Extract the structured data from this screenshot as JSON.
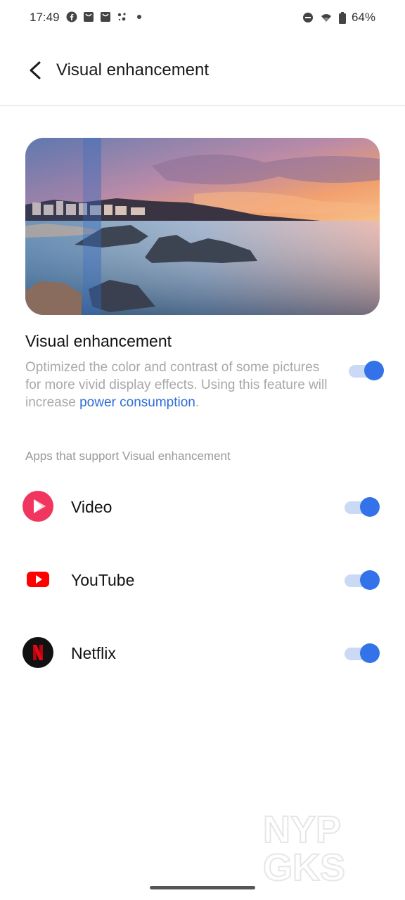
{
  "status_bar": {
    "time": "17:49",
    "battery": "64%",
    "left_icons": [
      "facebook-icon",
      "notification-bag-icon",
      "notification-bag-icon",
      "assistant-dots-icon",
      "dot-icon"
    ],
    "right_icons": [
      "do-not-disturb-icon",
      "wifi-icon",
      "battery-icon"
    ]
  },
  "header": {
    "title": "Visual enhancement",
    "back_icon": "chevron-left-icon"
  },
  "feature": {
    "title": "Visual enhancement",
    "description": "Optimized the color and contrast of some pictures for more vivid display effects. Using this feature will increase ",
    "link": "power consumption",
    "description_end": ".",
    "enabled": true
  },
  "apps_section": {
    "label": "Apps that support Visual enhancement",
    "apps": [
      {
        "name": "Video",
        "icon": "video-play-icon",
        "enabled": true
      },
      {
        "name": "YouTube",
        "icon": "youtube-icon",
        "enabled": true
      },
      {
        "name": "Netflix",
        "icon": "netflix-icon",
        "enabled": true
      }
    ]
  },
  "watermark": {
    "line1": "NYP",
    "line2": "GKS"
  },
  "colors": {
    "accent": "#3372e9",
    "track": "#c9d9f6",
    "link": "#2f6cd8",
    "youtube_red": "#ff0000",
    "video_pink": "#f0365e",
    "netflix_red": "#e50914"
  }
}
